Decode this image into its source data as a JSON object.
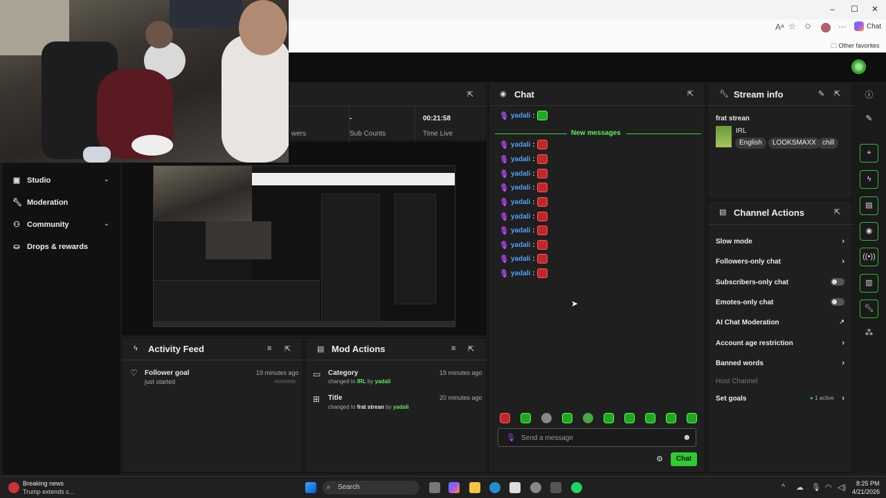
{
  "browser": {
    "chat_label": "Chat",
    "other_favorites": "Other favorites",
    "window_controls": [
      "–",
      "☐",
      "✕"
    ]
  },
  "nav": {
    "items": [
      {
        "label": "Studio",
        "icon": "studio-icon",
        "expandable": true
      },
      {
        "label": "Moderation",
        "icon": "wrench-icon",
        "expandable": false
      },
      {
        "label": "Community",
        "icon": "community-icon",
        "expandable": true
      },
      {
        "label": "Drops & rewards",
        "icon": "drops-icon",
        "expandable": false
      }
    ]
  },
  "stats": {
    "followers_suffix": "wers",
    "sub_counts_value": "-",
    "sub_counts_label": "Sub Counts",
    "time_live_value": "00:21:58",
    "time_live_label": "Time Live"
  },
  "activity_feed": {
    "title": "Activity Feed",
    "item_title": "Follower goal",
    "item_sub": "just started",
    "item_time": "19 minutes ago"
  },
  "mod_actions": {
    "title": "Mod Actions",
    "items": [
      {
        "title": "Category",
        "prefix": "changed to ",
        "value": "IRL",
        "by": " by ",
        "user": "yadali",
        "time": "19 minutes ago"
      },
      {
        "title": "Title",
        "prefix": "changed to ",
        "value": "frat strean",
        "by": " by ",
        "user": "yadali",
        "time": "20 minutes ago"
      }
    ]
  },
  "chat": {
    "title": "Chat",
    "username": "yadali",
    "new_messages": "New messages",
    "placeholder": "Send a message",
    "send_label": "Chat"
  },
  "stream_info": {
    "title": "Stream info",
    "stream_title": "frat strean",
    "category": "IRL",
    "tags": [
      "English",
      "LOOKSMAXX",
      "chill"
    ]
  },
  "channel_actions": {
    "title": "Channel Actions",
    "items": [
      {
        "label": "Slow mode",
        "control": "chevron"
      },
      {
        "label": "Followers-only chat",
        "control": "chevron"
      },
      {
        "label": "Subscribers-only chat",
        "control": "toggle"
      },
      {
        "label": "Emotes-only chat",
        "control": "toggle"
      },
      {
        "label": "AI Chat Moderation",
        "control": "external"
      },
      {
        "label": "Account age restriction",
        "control": "chevron"
      },
      {
        "label": "Banned words",
        "control": "chevron"
      },
      {
        "label": "Host Channel",
        "control": "none"
      },
      {
        "label": "Set goals",
        "control": "chevron"
      }
    ],
    "goals_status": "1 active"
  },
  "taskbar": {
    "news_title": "Breaking news",
    "news_sub": "Trump extends c...",
    "search_label": "Search",
    "time": "8:25 PM",
    "date": "4/21/2026"
  },
  "colors": {
    "accent_green": "#2ecc2e",
    "username_blue": "#4da3ff",
    "emote_red": "#c0262a"
  }
}
